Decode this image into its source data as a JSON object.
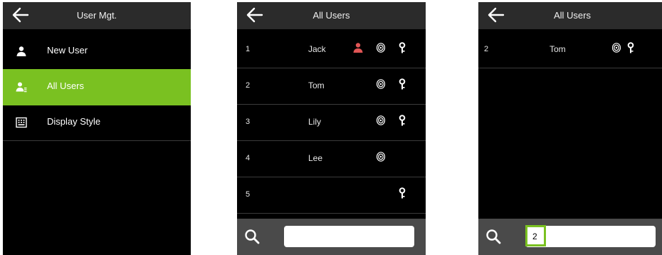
{
  "colors": {
    "accent": "#7ac121",
    "background": "#000000",
    "header": "#2b2b2b",
    "search_bar": "#4a4a4a",
    "person_icon": "#e05555"
  },
  "screens": [
    {
      "title": "User Mgt.",
      "menu": [
        {
          "label": "New User",
          "icon": "person-icon",
          "active": false
        },
        {
          "label": "All Users",
          "icon": "users-icon",
          "active": true
        },
        {
          "label": "Display Style",
          "icon": "display-icon",
          "active": false
        }
      ]
    },
    {
      "title": "All Users",
      "rows": [
        {
          "id": "1",
          "name": "Jack",
          "person": true,
          "fingerprint": true,
          "key": true
        },
        {
          "id": "2",
          "name": "Tom",
          "person": false,
          "fingerprint": true,
          "key": true
        },
        {
          "id": "3",
          "name": "Lily",
          "person": false,
          "fingerprint": true,
          "key": true
        },
        {
          "id": "4",
          "name": "Lee",
          "person": false,
          "fingerprint": true,
          "key": false
        },
        {
          "id": "5",
          "name": "",
          "person": false,
          "fingerprint": false,
          "key": true
        }
      ],
      "search": {
        "value": ""
      }
    },
    {
      "title": "All Users",
      "rows": [
        {
          "id": "2",
          "name": "Tom",
          "person": false,
          "fingerprint": true,
          "key": true
        }
      ],
      "search": {
        "value": "2"
      }
    }
  ]
}
